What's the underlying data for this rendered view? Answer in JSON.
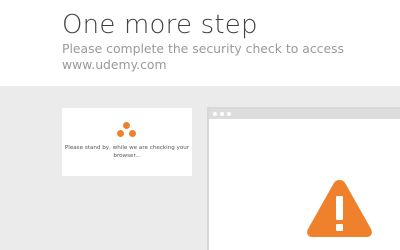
{
  "header": {
    "title": "One more step",
    "subtitle": "Please complete the security check to access www.udemy.com"
  },
  "loader": {
    "message": "Please stand by, while we are checking your browser..."
  },
  "colors": {
    "accent": "#f0812c",
    "page_background": "#ebebeb",
    "card_background": "#ffffff"
  },
  "icons": {
    "loader": "three-dot-loader-icon",
    "warning": "warning-triangle-icon",
    "browser_dots": "window-dots-icon"
  }
}
